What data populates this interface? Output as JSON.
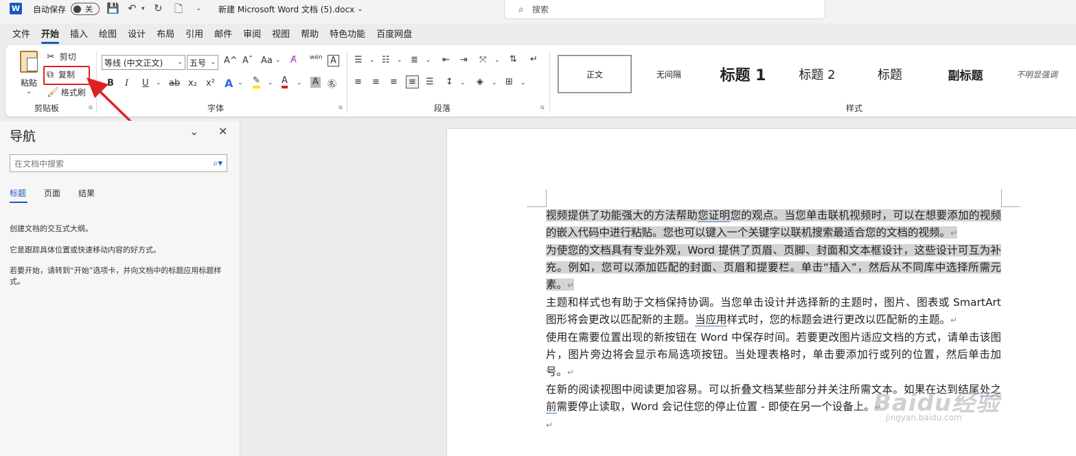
{
  "titlebar": {
    "logo": "W",
    "autosave_label": "自动保存",
    "autosave_state": "关",
    "doc_title": "新建 Microsoft Word 文档 (5).docx",
    "search_placeholder": "搜索"
  },
  "menu_tabs": [
    "文件",
    "开始",
    "插入",
    "绘图",
    "设计",
    "布局",
    "引用",
    "邮件",
    "审阅",
    "视图",
    "帮助",
    "特色功能",
    "百度网盘"
  ],
  "active_menu_tab": "开始",
  "ribbon": {
    "clipboard": {
      "paste": "粘贴",
      "cut": "剪切",
      "copy": "复制",
      "format_painter": "格式刷",
      "label": "剪贴板"
    },
    "font": {
      "font_name": "等线 (中文正文)",
      "font_size": "五号",
      "label": "字体",
      "grow": "A^",
      "shrink": "Aˇ",
      "change_case": "Aa",
      "bold": "B",
      "italic": "I",
      "underline": "U",
      "strike": "ab",
      "subscript": "x₂",
      "superscript": "x²",
      "phonetic_guide": "wén"
    },
    "paragraph": {
      "label": "段落"
    },
    "styles": {
      "label": "样式",
      "items": [
        "正文",
        "无间隔",
        "标题 1",
        "标题 2",
        "标题",
        "副标题",
        "不明显强调"
      ]
    }
  },
  "nav": {
    "title": "导航",
    "search_placeholder": "在文档中搜索",
    "tabs": [
      "标题",
      "页面",
      "结果"
    ],
    "text1": "创建文档的交互式大纲。",
    "text2": "它是跟踪具体位置或快速移动内容的好方式。",
    "text3": "若要开始，请转到“开始”选项卡，并向文档中的标题应用标题样式。"
  },
  "document": {
    "p1a": "视频提供了功能强大的方法帮助",
    "p1b": "您证明",
    "p1c": "您的观点。当您单击联机视频时，可以在想要添加的视频的嵌入代码中进行粘贴。您也可以键入一个关键字以联机搜索最适合您的文档的视频。",
    "p2": "为使您的文档具有专业外观，Word 提供了页眉、页脚、封面和文本框设计，这些设计可互为补充。例如，您可以添加匹配的封面、页眉和提要栏。单击“插入”，然后从不同库中选择所需元素。",
    "p3a": "主题和样式也有助于文档保持协调。当您单击设计并选择新的主题时，图片、图表或 SmartArt 图形将会更改以匹配新的主题。",
    "p3b": "当应用",
    "p3c": "样式时，您的标题会进行更改以匹配新的主题。",
    "p4": "使用在需要位置出现的新按钮在 Word 中保存时间。若要更改图片适应文档的方式，请单击该图片，图片旁边将会显示布局选项按钮。当处理表格时，单击要添加行或列的位置，然后单击加号。",
    "p5a": "在新的阅读视图中阅读更加容易。可以折叠文档某些部分并关注所需文本。如果在达到结尾",
    "p5b": "处之前",
    "p5c": "需要停止读取，Word 会记住您的停止位置 - 即使在另一个设备上。"
  },
  "watermark": {
    "main": "Baidu经验",
    "sub": "jingyan.baidu.com"
  },
  "colors": {
    "accent": "#185abd",
    "highlight_box": "#e02020",
    "selection": "#d4d4d4"
  }
}
